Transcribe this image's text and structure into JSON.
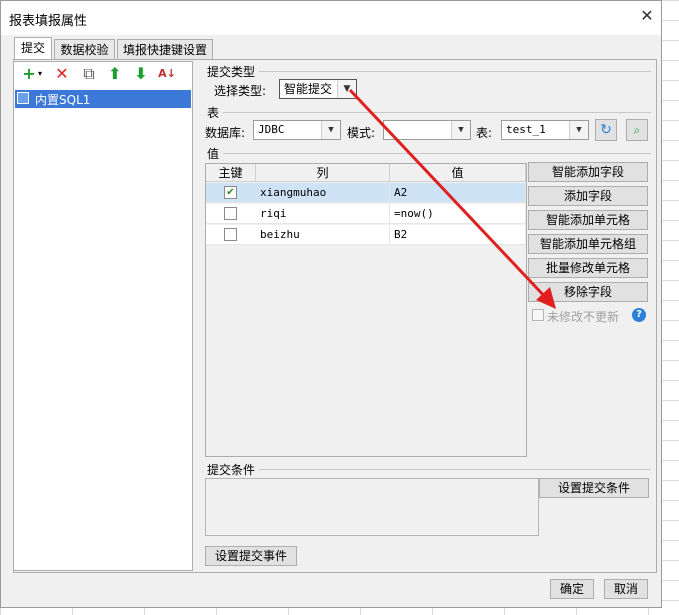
{
  "window": {
    "title": "报表填报属性",
    "close_glyph": "✕"
  },
  "tabs": [
    {
      "label": "提交"
    },
    {
      "label": "数据校验"
    },
    {
      "label": "填报快捷键设置"
    }
  ],
  "left_panel": {
    "toolbar": [
      "add-icon",
      "delete-icon",
      "copy-icon",
      "move-up-icon",
      "move-down-icon",
      "sort-icon"
    ],
    "items": [
      {
        "label": "内置SQL1"
      }
    ]
  },
  "submit_type": {
    "group_label": "提交类型",
    "label": "选择类型:",
    "value": "智能提交"
  },
  "table_section": {
    "group_label": "表",
    "database_label": "数据库:",
    "database_value": "JDBC",
    "schema_label": "模式:",
    "schema_value": "",
    "table_label": "表:",
    "table_value": "test_1"
  },
  "value_section": {
    "group_label": "值",
    "columns": [
      "主键",
      "列",
      "值"
    ],
    "rows": [
      {
        "key": true,
        "column": "xiangmuhao",
        "value": "A2"
      },
      {
        "key": false,
        "column": "riqi",
        "value": "=now()"
      },
      {
        "key": false,
        "column": "beizhu",
        "value": "B2"
      }
    ],
    "buttons": [
      "智能添加字段",
      "添加字段",
      "智能添加单元格",
      "智能添加单元格组",
      "批量修改单元格",
      "移除字段"
    ],
    "no_update_label": "未修改不更新"
  },
  "condition_section": {
    "group_label": "提交条件",
    "set_condition_button": "设置提交条件",
    "set_event_button": "设置提交事件"
  },
  "footer": {
    "ok": "确定",
    "cancel": "取消"
  },
  "colors": {
    "selection": "#3b78d8",
    "annotation_arrow": "#e02020",
    "row_selected": "#cfe3f6"
  }
}
